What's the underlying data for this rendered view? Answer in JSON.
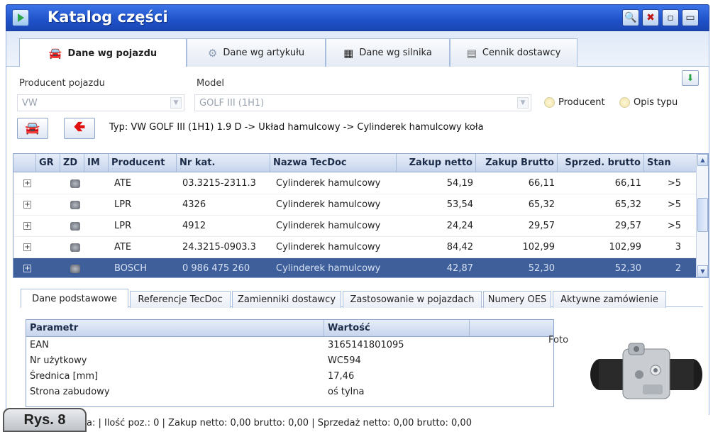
{
  "window": {
    "title": "Katalog części"
  },
  "top_tabs": [
    {
      "label": "Dane wg pojazdu",
      "icon": "car-icon",
      "active": true
    },
    {
      "label": "Dane wg artykułu",
      "icon": "gear-icon",
      "active": false
    },
    {
      "label": "Dane wg silnika",
      "icon": "engine-icon",
      "active": false
    },
    {
      "label": "Cennik dostawcy",
      "icon": "list-icon",
      "active": false
    }
  ],
  "form": {
    "producer_label": "Producent pojazdu",
    "producer_value": "VW",
    "model_label": "Model",
    "model_value": "GOLF III (1H1)",
    "radio_producer": "Producent",
    "radio_type": "Opis typu",
    "path": "Typ: VW GOLF III (1H1) 1.9 D -> Układ hamulcowy -> Cylinderek hamulcowy koła"
  },
  "grid": {
    "headers": [
      "GR",
      "ZD",
      "IM",
      "Producent",
      "Nr kat.",
      "Nazwa TecDoc",
      "Zakup netto",
      "Zakup Brutto",
      "Sprzed. brutto",
      "Stan"
    ],
    "rows": [
      {
        "producer": "ATE",
        "nr": "03.3215-2311.3",
        "name": "Cylinderek hamulcowy",
        "netto": "54,19",
        "brutto": "66,11",
        "sprzed": "66,11",
        "stan": ">5"
      },
      {
        "producer": "LPR",
        "nr": "4326",
        "name": "Cylinderek hamulcowy",
        "netto": "53,54",
        "brutto": "65,32",
        "sprzed": "65,32",
        "stan": ">5"
      },
      {
        "producer": "LPR",
        "nr": "4912",
        "name": "Cylinderek hamulcowy",
        "netto": "24,24",
        "brutto": "29,57",
        "sprzed": "29,57",
        "stan": ">5"
      },
      {
        "producer": "ATE",
        "nr": "24.3215-0903.3",
        "name": "Cylinderek hamulcowy",
        "netto": "84,42",
        "brutto": "102,99",
        "sprzed": "102,99",
        "stan": "3"
      },
      {
        "producer": "BOSCH",
        "nr": "0 986 475 260",
        "name": "Cylinderek hamulcowy",
        "netto": "42,87",
        "brutto": "52,30",
        "sprzed": "52,30",
        "stan": "2"
      }
    ]
  },
  "bottom_tabs": [
    "Dane podstawowe",
    "Referencje TecDoc",
    "Zamienniki dostawcy",
    "Zastosowanie w pojazdach",
    "Numery OES",
    "Aktywne zamówienie"
  ],
  "details": {
    "header_param": "Parametr",
    "header_value": "Wartość",
    "rows": [
      {
        "param": "EAN",
        "value": "3165141801095"
      },
      {
        "param": "Nr użytkowy",
        "value": "WC594"
      },
      {
        "param": "Średnica [mm]",
        "value": "17,46"
      },
      {
        "param": "Strona zabudowy",
        "value": "oś tylna"
      }
    ],
    "foto_label": "Foto"
  },
  "status": {
    "text": "a:  |  Ilość poz.: 0  |  Zakup netto: 0,00  brutto: 0,00  |  Sprzedaż netto: 0,00  brutto: 0,00",
    "badge": "Rys. 8"
  }
}
